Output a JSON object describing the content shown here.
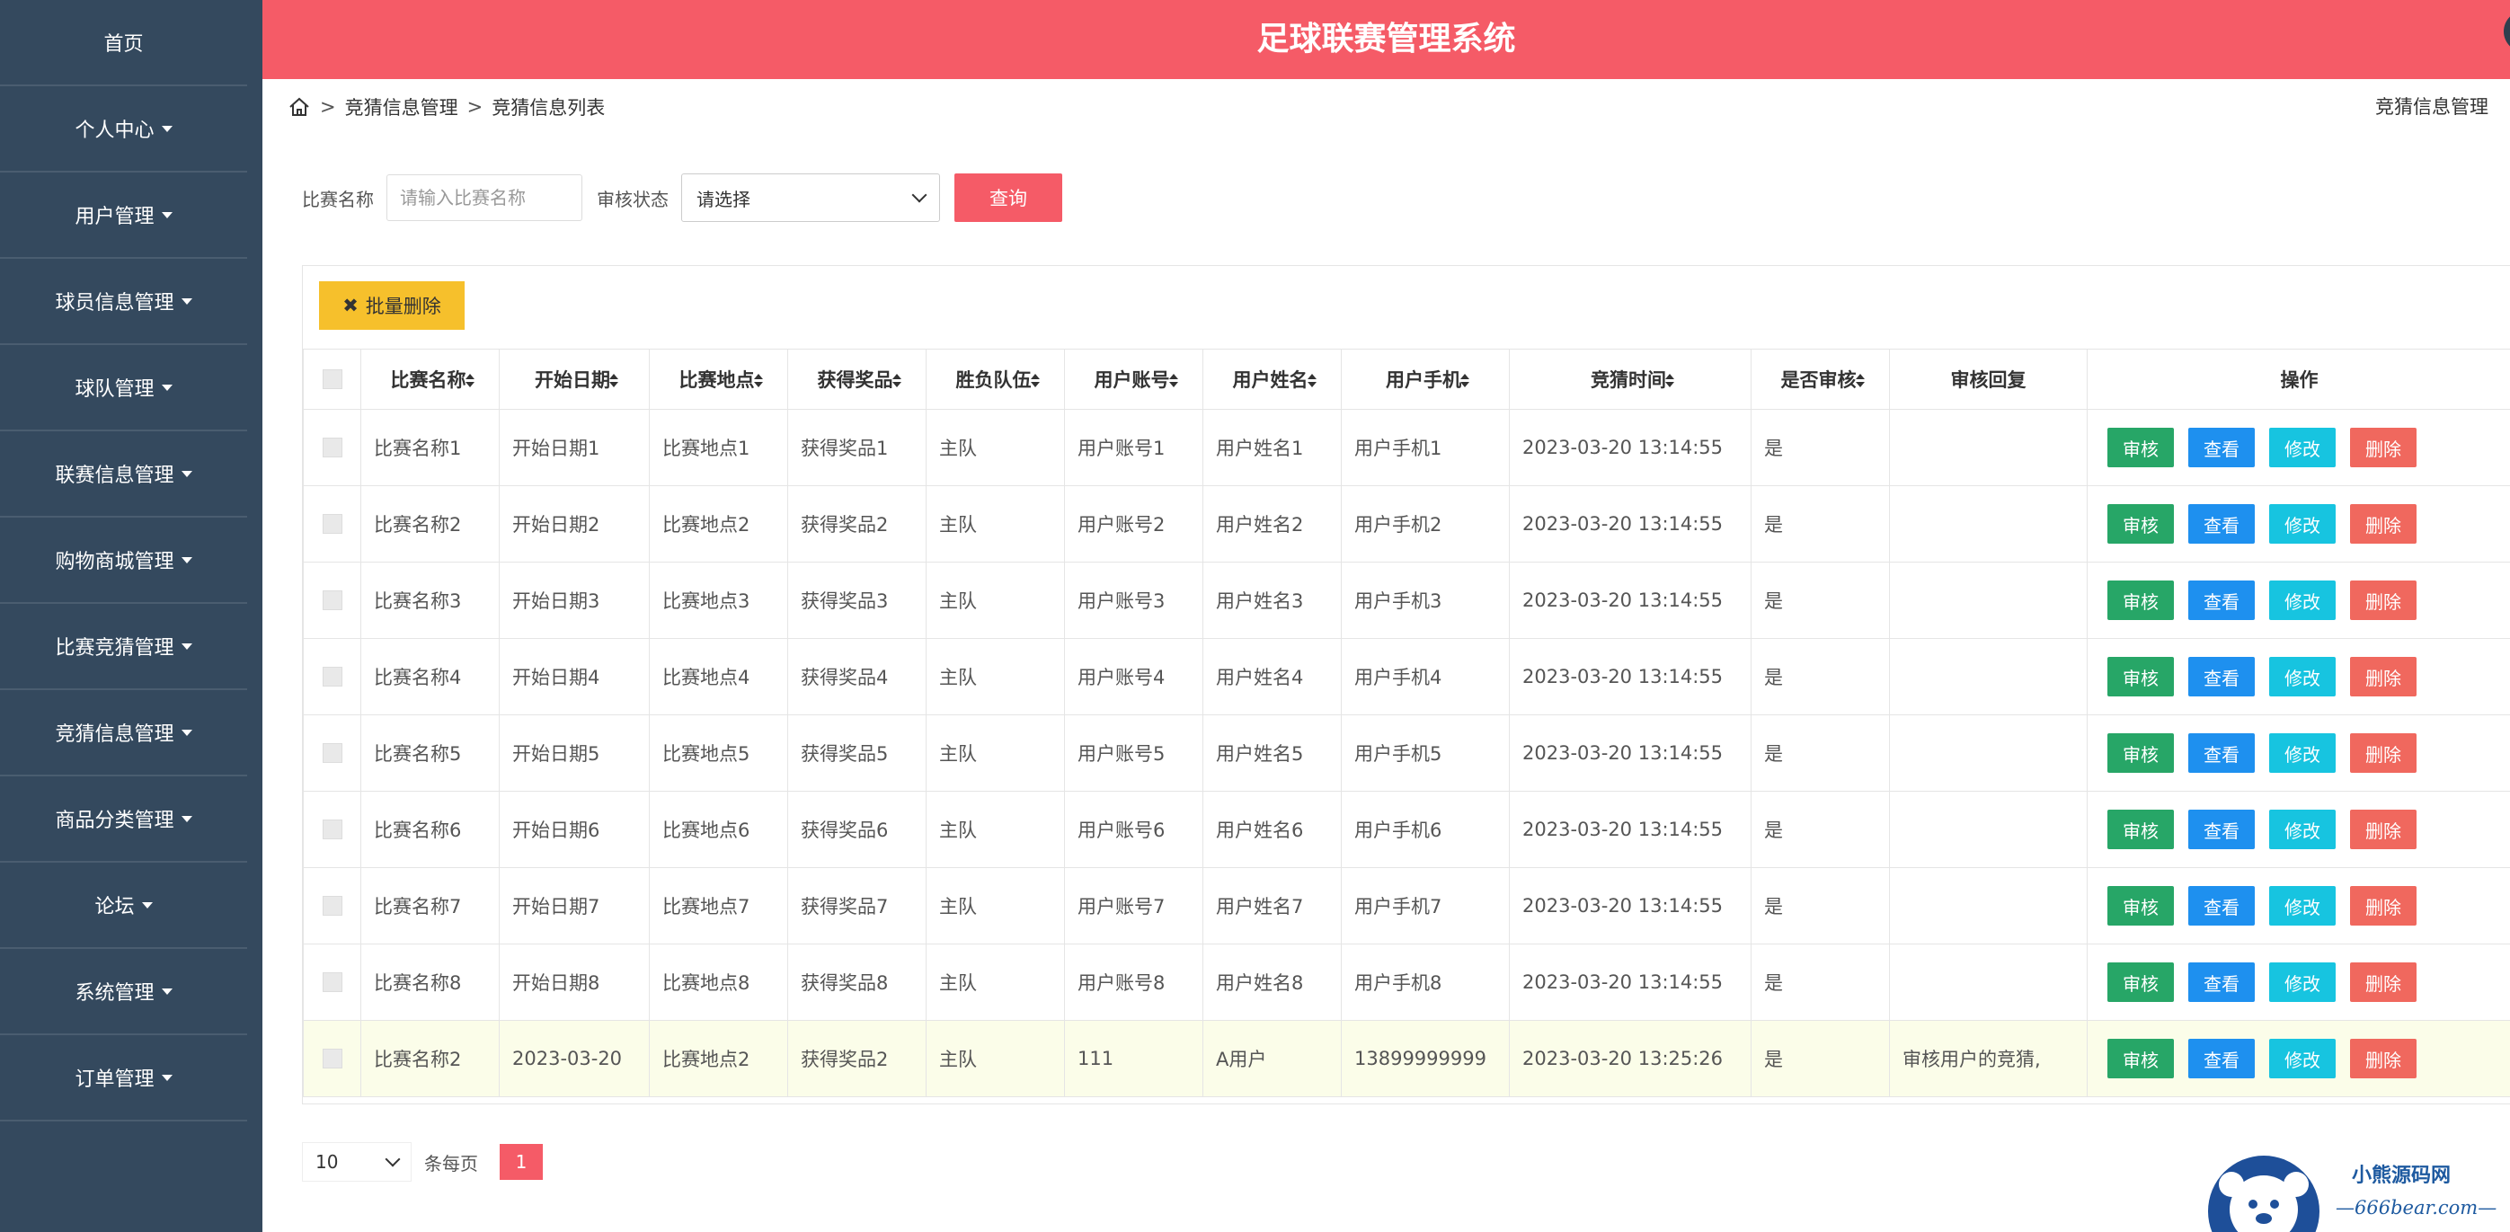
{
  "app": {
    "title": "足球联赛管理系统"
  },
  "sidebar": {
    "items": [
      {
        "label": "首页",
        "caret": false
      },
      {
        "label": "个人中心",
        "caret": true
      },
      {
        "label": "用户管理",
        "caret": true
      },
      {
        "label": "球员信息管理",
        "caret": true
      },
      {
        "label": "球队管理",
        "caret": true
      },
      {
        "label": "联赛信息管理",
        "caret": true
      },
      {
        "label": "购物商城管理",
        "caret": true
      },
      {
        "label": "比赛竞猜管理",
        "caret": true
      },
      {
        "label": "竞猜信息管理",
        "caret": true
      },
      {
        "label": "商品分类管理",
        "caret": true
      },
      {
        "label": "论坛",
        "caret": true
      },
      {
        "label": "系统管理",
        "caret": true
      },
      {
        "label": "订单管理",
        "caret": true
      }
    ]
  },
  "breadcrumb": {
    "items": [
      "竞猜信息管理",
      "竞猜信息列表"
    ],
    "sep": ">",
    "right": "竞猜信息管理"
  },
  "search": {
    "name_label": "比赛名称",
    "name_placeholder": "请输入比赛名称",
    "status_label": "审核状态",
    "status_value": "请选择",
    "query_label": "查询"
  },
  "toolbar": {
    "batch_delete_label": "批量删除"
  },
  "table": {
    "headers": [
      "比赛名称",
      "开始日期",
      "比赛地点",
      "获得奖品",
      "胜负队伍",
      "用户账号",
      "用户姓名",
      "用户手机",
      "竞猜时间",
      "是否审核",
      "审核回复",
      "操作"
    ],
    "rows": [
      [
        "比赛名称1",
        "开始日期1",
        "比赛地点1",
        "获得奖品1",
        "主队",
        "用户账号1",
        "用户姓名1",
        "用户手机1",
        "2023-03-20 13:14:55",
        "是",
        ""
      ],
      [
        "比赛名称2",
        "开始日期2",
        "比赛地点2",
        "获得奖品2",
        "主队",
        "用户账号2",
        "用户姓名2",
        "用户手机2",
        "2023-03-20 13:14:55",
        "是",
        ""
      ],
      [
        "比赛名称3",
        "开始日期3",
        "比赛地点3",
        "获得奖品3",
        "主队",
        "用户账号3",
        "用户姓名3",
        "用户手机3",
        "2023-03-20 13:14:55",
        "是",
        ""
      ],
      [
        "比赛名称4",
        "开始日期4",
        "比赛地点4",
        "获得奖品4",
        "主队",
        "用户账号4",
        "用户姓名4",
        "用户手机4",
        "2023-03-20 13:14:55",
        "是",
        ""
      ],
      [
        "比赛名称5",
        "开始日期5",
        "比赛地点5",
        "获得奖品5",
        "主队",
        "用户账号5",
        "用户姓名5",
        "用户手机5",
        "2023-03-20 13:14:55",
        "是",
        ""
      ],
      [
        "比赛名称6",
        "开始日期6",
        "比赛地点6",
        "获得奖品6",
        "主队",
        "用户账号6",
        "用户姓名6",
        "用户手机6",
        "2023-03-20 13:14:55",
        "是",
        ""
      ],
      [
        "比赛名称7",
        "开始日期7",
        "比赛地点7",
        "获得奖品7",
        "主队",
        "用户账号7",
        "用户姓名7",
        "用户手机7",
        "2023-03-20 13:14:55",
        "是",
        ""
      ],
      [
        "比赛名称8",
        "开始日期8",
        "比赛地点8",
        "获得奖品8",
        "主队",
        "用户账号8",
        "用户姓名8",
        "用户手机8",
        "2023-03-20 13:14:55",
        "是",
        ""
      ],
      [
        "比赛名称2",
        "2023-03-20",
        "比赛地点2",
        "获得奖品2",
        "主队",
        "111",
        "A用户",
        "13899999999",
        "2023-03-20 13:25:26",
        "是",
        "审核用户的竞猜,"
      ]
    ],
    "highlight_row": 8,
    "actions": [
      "审核",
      "查看",
      "修改",
      "删除"
    ]
  },
  "pager": {
    "page_size": "10",
    "per_page_label": "条每页",
    "current_page": "1"
  },
  "watermark": {
    "line1": "小熊源码网",
    "line2": "—666bear.com—"
  },
  "colors": {
    "header": "#f55b67",
    "sidebar": "#34495e",
    "audit": "#27a667",
    "view": "#1e90ef",
    "edit": "#17c4e0",
    "delete": "#f0685e",
    "batch": "#f6c02c"
  }
}
